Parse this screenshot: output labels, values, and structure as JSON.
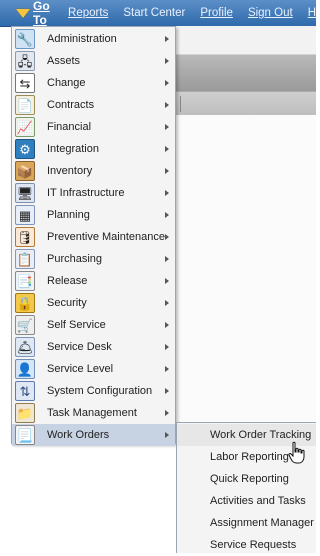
{
  "topbar": {
    "goto_label": "Go To",
    "links": [
      "Reports",
      "Start Center",
      "Profile",
      "Sign Out",
      "H"
    ]
  },
  "menu": {
    "items": [
      {
        "label": "Administration",
        "icon": "administration-icon"
      },
      {
        "label": "Assets",
        "icon": "assets-icon"
      },
      {
        "label": "Change",
        "icon": "change-icon"
      },
      {
        "label": "Contracts",
        "icon": "contracts-icon"
      },
      {
        "label": "Financial",
        "icon": "financial-icon"
      },
      {
        "label": "Integration",
        "icon": "integration-icon"
      },
      {
        "label": "Inventory",
        "icon": "inventory-icon"
      },
      {
        "label": "IT Infrastructure",
        "icon": "it-infrastructure-icon"
      },
      {
        "label": "Planning",
        "icon": "planning-icon"
      },
      {
        "label": "Preventive Maintenance",
        "icon": "preventive-maintenance-icon"
      },
      {
        "label": "Purchasing",
        "icon": "purchasing-icon"
      },
      {
        "label": "Release",
        "icon": "release-icon"
      },
      {
        "label": "Security",
        "icon": "security-icon"
      },
      {
        "label": "Self Service",
        "icon": "self-service-icon"
      },
      {
        "label": "Service Desk",
        "icon": "service-desk-icon"
      },
      {
        "label": "Service Level",
        "icon": "service-level-icon"
      },
      {
        "label": "System Configuration",
        "icon": "system-configuration-icon"
      },
      {
        "label": "Task Management",
        "icon": "task-management-icon"
      },
      {
        "label": "Work Orders",
        "icon": "work-orders-icon"
      }
    ]
  },
  "submenu": {
    "items": [
      "Work Order Tracking",
      "Labor Reporting",
      "Quick Reporting",
      "Activities and Tasks",
      "Assignment Manager",
      "Service Requests"
    ]
  },
  "colors": {
    "topbar": "#2f6aab",
    "menu_bg": "#f4f4f4",
    "active_item": "#c7d2e2"
  }
}
